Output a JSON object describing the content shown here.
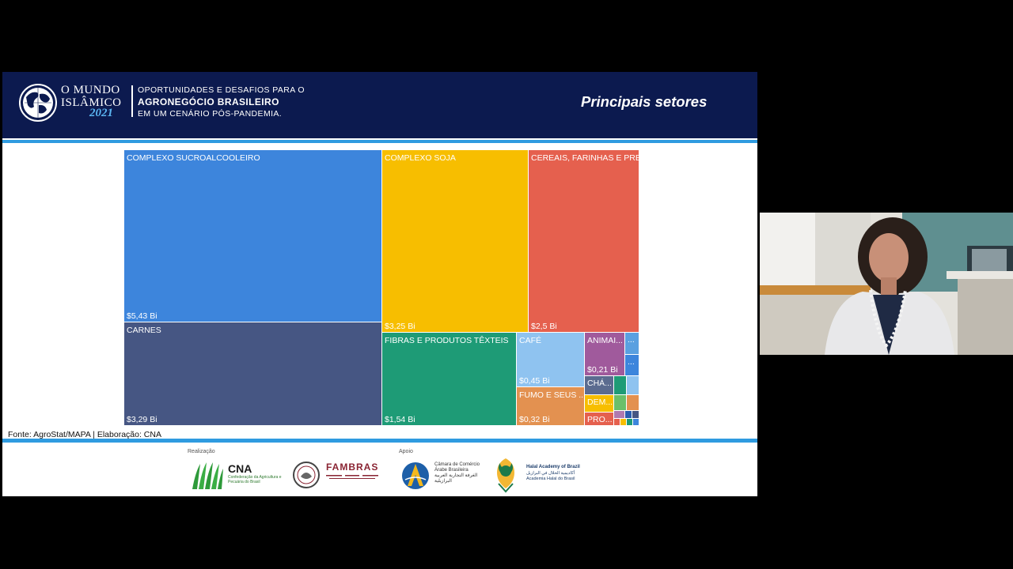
{
  "slide": {
    "brand": {
      "line1": "O MUNDO",
      "line2": "ISLÂMICO",
      "year": "2021"
    },
    "subtitle": {
      "line1": "OPORTUNIDADES E DESAFIOS PARA O",
      "line2": "AGRONEGÓCIO BRASILEIRO",
      "line3": "EM UM CENÁRIO PÓS-PANDEMIA."
    },
    "title": "Principais setores",
    "source": "Fonte: AgroStat/MAPA | Elaboração: CNA",
    "colors": {
      "header": "#0c1a4f",
      "accent": "#2f9be0",
      "year": "#5ab4f0"
    }
  },
  "chart_data": {
    "type": "treemap",
    "tiles": [
      {
        "label": "COMPLEXO SUCROALCOOLEIRO",
        "value_label": "$5,43 Bi",
        "value": 5.43,
        "color": "#3d85dc"
      },
      {
        "label": "CARNES",
        "value_label": "$3,29 Bi",
        "value": 3.29,
        "color": "#465683"
      },
      {
        "label": "COMPLEXO SOJA",
        "value_label": "$3,25 Bi",
        "value": 3.25,
        "color": "#f7be00"
      },
      {
        "label": "CEREAIS, FARINHAS E PRE...",
        "value_label": "$2,5 Bi",
        "value": 2.5,
        "color": "#e5604e"
      },
      {
        "label": "FIBRAS E PRODUTOS TÊXTEIS",
        "value_label": "$1,54 Bi",
        "value": 1.54,
        "color": "#1e9b76"
      },
      {
        "label": "CAFÉ",
        "value_label": "$0,45 Bi",
        "value": 0.45,
        "color": "#8fc3f0"
      },
      {
        "label": "FUMO E SEUS ...",
        "value_label": "$0,32 Bi",
        "value": 0.32,
        "color": "#e39150"
      },
      {
        "label": "ANIMAI...",
        "value_label": "$0,21 Bi",
        "value": 0.21,
        "color": "#a05a9c"
      },
      {
        "label": "...",
        "value_label": "",
        "color": "#5aa0e0"
      },
      {
        "label": "...",
        "value_label": "",
        "color": "#3d85dc"
      },
      {
        "label": "CHÁ...",
        "value_label": "",
        "color": "#5b6b8f"
      },
      {
        "label": "DEM...",
        "value_label": "",
        "color": "#f7be00"
      },
      {
        "label": "PRO...",
        "value_label": "",
        "color": "#e5604e"
      },
      {
        "label": "",
        "value_label": "",
        "color": "#1e9b76"
      },
      {
        "label": "",
        "value_label": "",
        "color": "#8fc3f0"
      },
      {
        "label": "",
        "value_label": "",
        "color": "#6abf6a"
      },
      {
        "label": "",
        "value_label": "",
        "color": "#e39150"
      },
      {
        "label": "",
        "value_label": "",
        "color": "#b07ab0"
      },
      {
        "label": "",
        "value_label": "",
        "color": "#2a5db0"
      },
      {
        "label": "",
        "value_label": "",
        "color": "#465683"
      },
      {
        "label": "",
        "value_label": "",
        "color": "#e5604e"
      },
      {
        "label": "",
        "value_label": "",
        "color": "#f7be00"
      },
      {
        "label": "",
        "value_label": "",
        "color": "#1e9b76"
      },
      {
        "label": "",
        "value_label": "",
        "color": "#3d85dc"
      }
    ]
  },
  "logos": {
    "realizacao_label": "Realização",
    "apoio_label": "Apoio",
    "cna": {
      "name": "CNA",
      "desc": "Confederação da Agricultura e Pecuária do Brasil"
    },
    "fambras": {
      "name": "FAMBRAS"
    },
    "ccab": {
      "name": "Câmara de Comércio Árabe Brasileira",
      "arabic": "الغرفة التجارية العربية البرازيلية"
    },
    "halal": {
      "name": "Halal Academy of Brazil",
      "desc": "أكاديمية الحلال في البرازيل Academia Halal do Brasil"
    }
  },
  "webcam": {
    "colors": {
      "wall": "#d9d6cf",
      "blazer": "#e8e8ea",
      "hair": "#2a1f1a"
    }
  }
}
